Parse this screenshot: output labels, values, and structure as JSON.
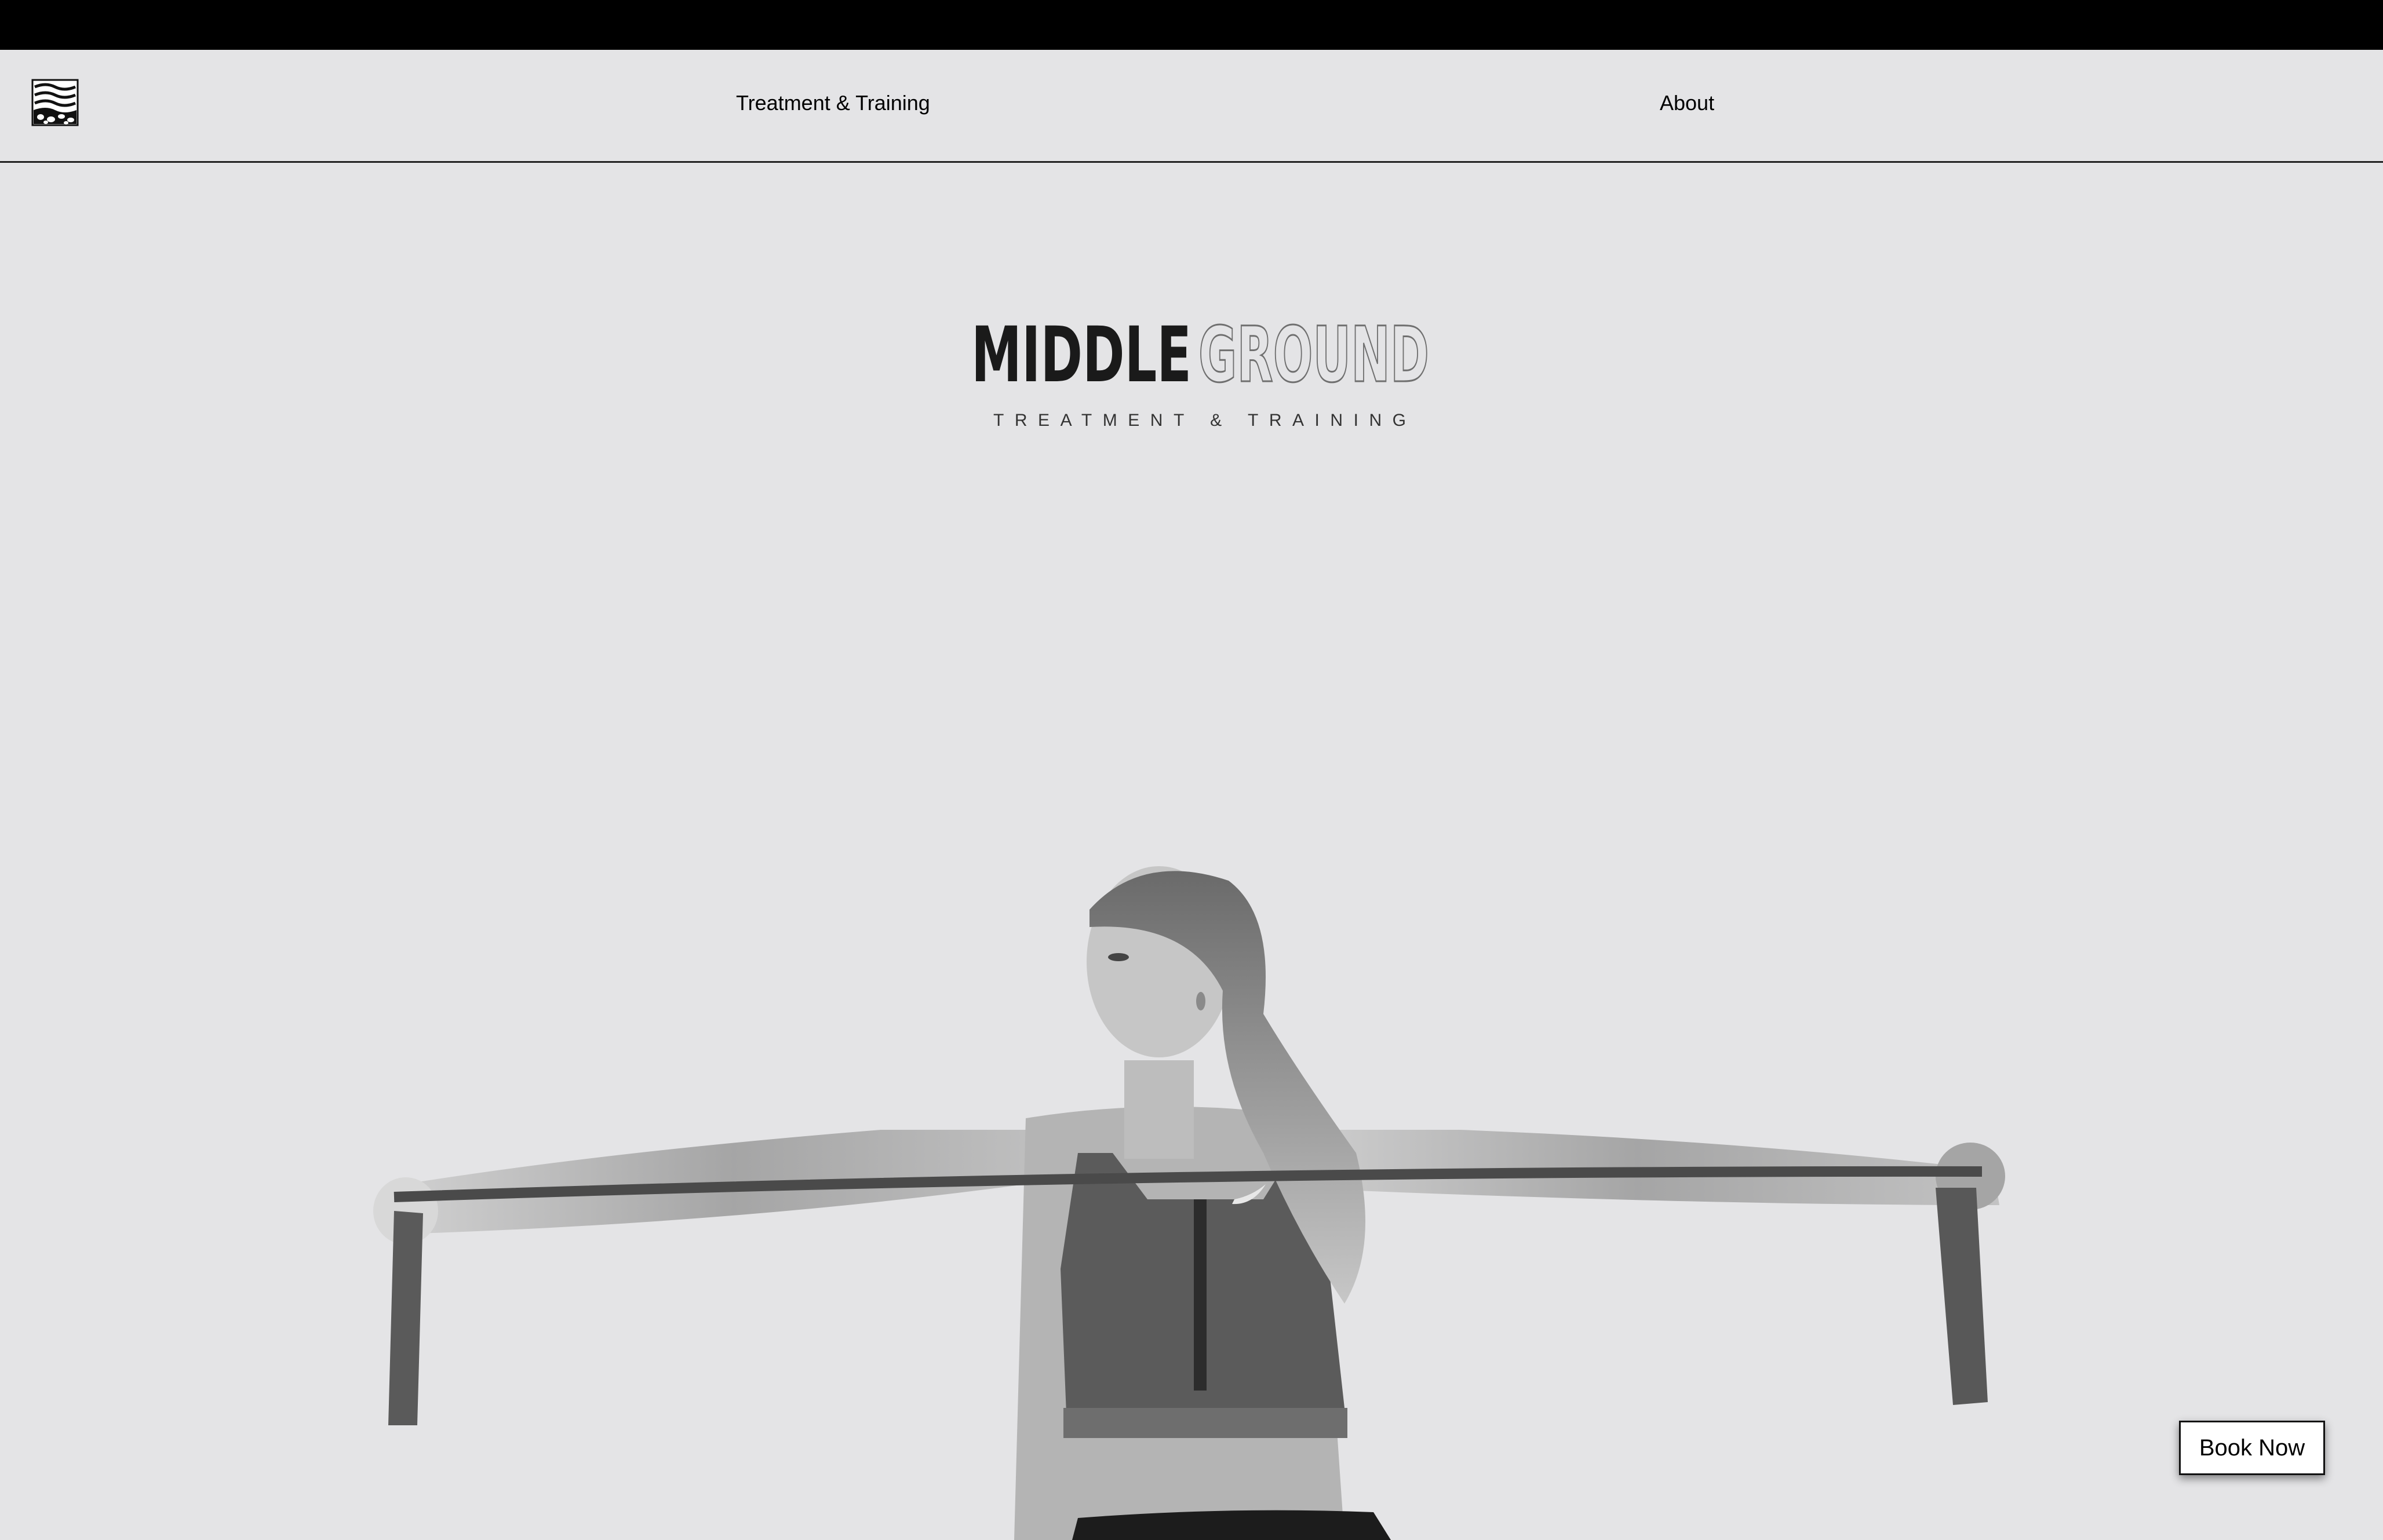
{
  "nav": {
    "logo_icon": "waves-pebbles-logo-icon",
    "links": [
      {
        "label": "Treatment & Training"
      },
      {
        "label": "About"
      }
    ]
  },
  "hero": {
    "brand_logo": {
      "word_solid": "MIDDLE",
      "word_outline": "GROUND",
      "tagline": "TREATMENT & TRAINING"
    },
    "photo_icon": "athlete-resistance-band-photo"
  },
  "cta": {
    "book_label": "Book Now"
  },
  "colors": {
    "background": "#e4e4e6",
    "top_bar": "#000000",
    "text": "#000000",
    "logo_solid": "#1a1a1a",
    "logo_outline": "#6f6f6f"
  }
}
